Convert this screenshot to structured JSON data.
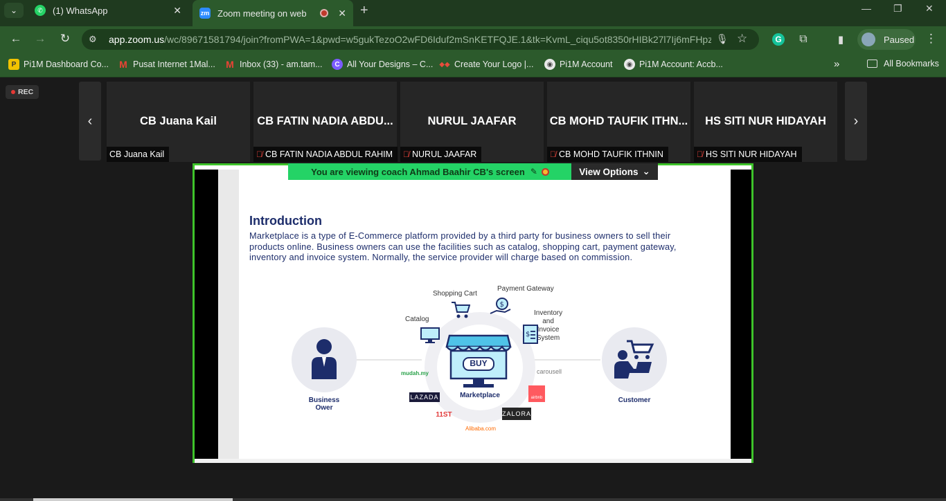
{
  "browser": {
    "tabs": [
      {
        "title": "(1) WhatsApp",
        "icon": "whatsapp-icon"
      },
      {
        "title": "Zoom meeting on web",
        "icon": "zoom-icon"
      }
    ],
    "url_host": "app.zoom.us",
    "url_rest": "/wc/89671581794/join?fromPWA=1&pwd=w5gukTezoO2wFD6Iduf2mSnKETFQJE.1&tk=KvmL_ciqu5ot8350rHIBk27l7Ij6mFHpz...",
    "profile_label": "Paused",
    "bookmarks": [
      "Pi1M Dashboard Co...",
      "Pusat Internet 1Mal...",
      "Inbox (33) - am.tam...",
      "All Your Designs – C...",
      "Create Your Logo |...",
      "Pi1M Account",
      "Pi1M Account: Accb..."
    ],
    "all_bookmarks": "All Bookmarks"
  },
  "zoom": {
    "rec_label": "REC",
    "participants": [
      {
        "display": "CB Juana Kail",
        "tag": "CB Juana Kail",
        "muted": false
      },
      {
        "display": "CB FATIN NADIA ABDU...",
        "tag": "CB FATIN NADIA ABDUL RAHIM",
        "muted": true
      },
      {
        "display": "NURUL JAAFAR",
        "tag": "NURUL JAAFAR",
        "muted": true
      },
      {
        "display": "CB MOHD TAUFIK ITHN...",
        "tag": "CB MOHD TAUFIK ITHNIN",
        "muted": true
      },
      {
        "display": "HS SITI NUR HIDAYAH",
        "tag": "HS SITI NUR HIDAYAH",
        "muted": true
      }
    ],
    "viewing_banner": "You are viewing  coach Ahmad Baahir CB's screen",
    "view_options": "View Options"
  },
  "slide": {
    "title": "Introduction",
    "body": "Marketplace is a type of E-Commerce platform provided by a third party for business owners to sell their products online. Business owners can use the facilities such as catalog, shopping cart, payment gateway, inventory and invoice system. Normally, the service provider will charge based on commission.",
    "labels": {
      "shopping_cart": "Shopping Cart",
      "payment_gateway": "Payment Gateway",
      "catalog": "Catalog",
      "inventory": "Inventory and\nInvoice System",
      "marketplace": "Marketplace",
      "business_owner": "Business\nOwer",
      "customer": "Customer",
      "buy": "BUY"
    },
    "logos": {
      "mudah": "mudah.my",
      "lazada": "LAZADA",
      "elevenst": "11ST",
      "alibaba": "Alibaba.com",
      "zalora": "ZALORA",
      "carousell": "carousell",
      "airbnb": "airbnb"
    }
  },
  "colors": {
    "chrome_dark": "#1f3a1f",
    "chrome": "#2c5a2c",
    "share_border": "#3ec32a",
    "slide_navy": "#1d2d6b"
  }
}
